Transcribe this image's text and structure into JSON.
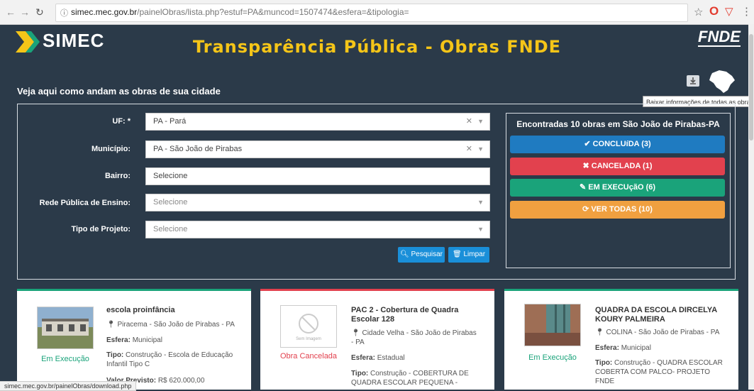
{
  "browser": {
    "url_host": "simec.mec.gov.br",
    "url_path": "/painelObras/lista.php?estuf=PA&muncod=1507474&esfera=&tipologia="
  },
  "header": {
    "logo_text": "SIMEC",
    "title": "Transparência Pública - Obras FNDE",
    "brand": "FNDE",
    "subtitle": "Veja aqui como andam as obras de sua cidade",
    "tooltip": "Baixar informações de todas as obras"
  },
  "form": {
    "uf_label": "UF: *",
    "uf_value": "PA - Pará",
    "municipio_label": "Município:",
    "municipio_value": "PA - São João de Pirabas",
    "bairro_label": "Bairro:",
    "bairro_value": "Selecione",
    "rede_label": "Rede Pública de Ensino:",
    "rede_value": "Selecione",
    "tipo_label": "Tipo de Projeto:",
    "tipo_value": "Selecione",
    "search_label": "Pesquisar",
    "clear_label": "Limpar"
  },
  "results": {
    "title": "Encontradas 10 obras em São João de Pirabas-PA",
    "concluida": "CONCLUíDA (3)",
    "cancelada": "CANCELADA (1)",
    "execucao": "EM EXECUçãO (6)",
    "todas": "VER TODAS (10)"
  },
  "colors": {
    "concluida": "#1f7bc1",
    "cancelada": "#e2414e",
    "execucao": "#1aa37a",
    "todas": "#f0a040",
    "accent_title": "#f5c518"
  },
  "cards": [
    {
      "title": "escola proinfância",
      "location": "Piracema - São João de Pirabas - PA",
      "esfera_label": "Esfera:",
      "esfera": "Municipal",
      "tipo_label": "Tipo:",
      "tipo": "Construção - Escola de Educação Infantil Tipo C",
      "valor_label": "Valor Previsto:",
      "valor": "R$ 620.000,00",
      "status": "Em Execução",
      "status_color": "#1aa37a"
    },
    {
      "title": "PAC 2 - Cobertura de Quadra Escolar 128",
      "location": "Cidade Velha - São João de Pirabas - PA",
      "esfera_label": "Esfera:",
      "esfera": "Estadual",
      "tipo_label": "Tipo:",
      "tipo": "Construção - COBERTURA DE QUADRA ESCOLAR PEQUENA -",
      "status": "Obra Cancelada",
      "status_color": "#e2414e",
      "no_image": "Sem Imagem"
    },
    {
      "title": "QUADRA DA ESCOLA DIRCELYA KOURY PALMEIRA",
      "location": "COLINA - São João de Pirabas - PA",
      "esfera_label": "Esfera:",
      "esfera": "Municipal",
      "tipo_label": "Tipo:",
      "tipo": "Construção - QUADRA ESCOLAR COBERTA COM PALCO- PROJETO FNDE",
      "status": "Em Execução",
      "status_color": "#1aa37a"
    }
  ],
  "statusbar": "simec.mec.gov.br/painelObras/download.php"
}
